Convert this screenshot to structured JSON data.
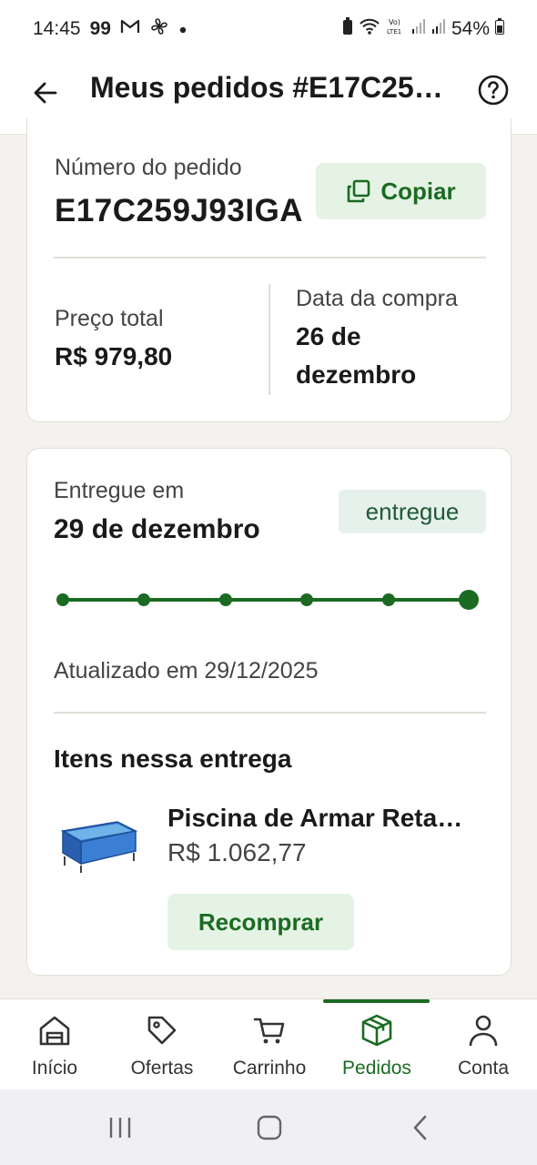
{
  "status_bar": {
    "time": "14:45",
    "left_badge": "99",
    "battery": "54%"
  },
  "app_bar": {
    "title": "Meus pedidos #E17C25…"
  },
  "order": {
    "number_label": "Número do pedido",
    "number_value": "E17C259J93IGA",
    "copy_label": "Copiar",
    "total_label": "Preço total",
    "total_value": "R$ 979,80",
    "date_label": "Data da compra",
    "date_value_line1": "26 de",
    "date_value_line2": "dezembro"
  },
  "delivery": {
    "delivered_label": "Entregue em",
    "delivered_date": "29 de dezembro",
    "status_badge": "entregue",
    "progress_steps": 6,
    "progress_completed": 6,
    "updated_text": "Atualizado em 29/12/2025",
    "items_title": "Itens nessa entrega",
    "item_name": "Piscina de Armar Reta…",
    "item_price": "R$ 1.062,77",
    "rebuy_label": "Recomprar"
  },
  "bottom_nav": {
    "items": [
      {
        "label": "Início",
        "icon": "home-icon"
      },
      {
        "label": "Ofertas",
        "icon": "tag-icon"
      },
      {
        "label": "Carrinho",
        "icon": "cart-icon"
      },
      {
        "label": "Pedidos",
        "icon": "package-icon"
      },
      {
        "label": "Conta",
        "icon": "user-icon"
      }
    ],
    "active": "Pedidos"
  },
  "colors": {
    "brand_green": "#1b6b22",
    "soft_green_bg": "#e5f3e5",
    "page_bg": "#f4f2ee"
  }
}
